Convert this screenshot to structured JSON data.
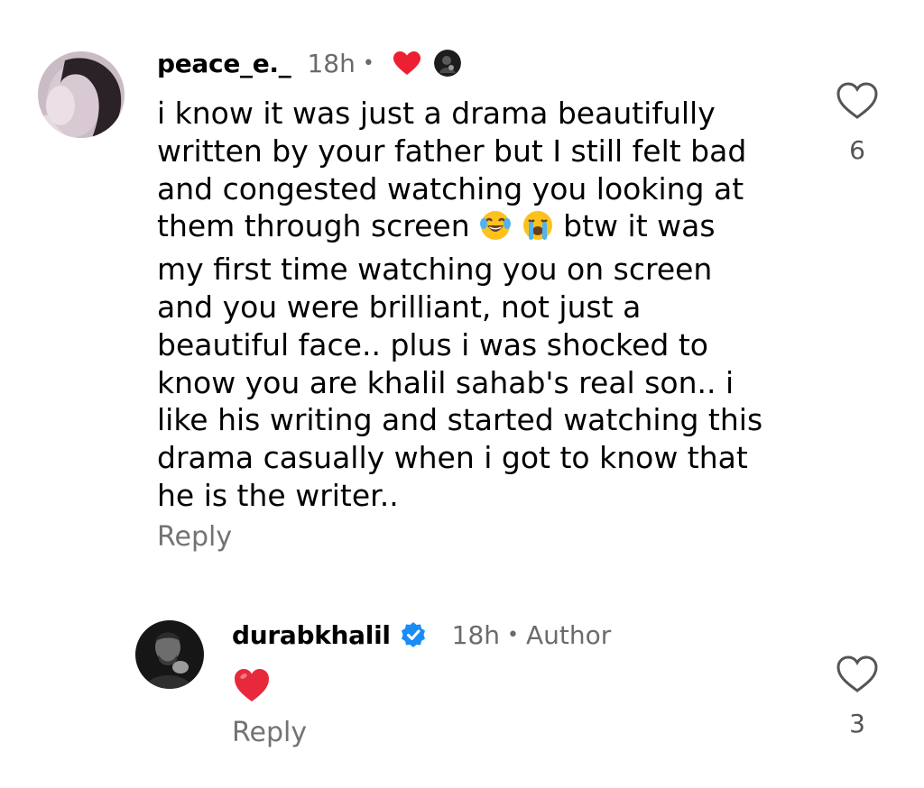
{
  "comments": [
    {
      "username": "peace_e._",
      "time": "18h",
      "separator": "•",
      "text_line_1": "i̇ know it was just a drama beautifully",
      "text_line_2": "written by your father but I still felt bad",
      "text_line_3": "and congested watching you looking at",
      "text_line_4_before": "them through screen",
      "text_line_4_emoji_1": "face-with-tears-of-joy-emoji",
      "text_line_4_emoji_2": "loudly-crying-face-emoji",
      "text_line_4_after": "btw it was",
      "text_line_5": "my first time watching you on screen",
      "text_line_6": "and you were brilliant, not just a",
      "text_line_7": "beautiful face.. plus i was shocked to",
      "text_line_8": "know you are khalil sahab's real son.. i",
      "text_line_9": "like his writing and started watching this",
      "text_line_10": "drama casually when i got to know that",
      "text_line_11": "he is the writer..",
      "reply_label": "Reply",
      "like_count": "6",
      "creator_liked_icon": "red-heart-icon",
      "like_icon": "heart-outline-icon"
    },
    {
      "username": "durabkhalil",
      "verified_icon": "verified-badge-icon",
      "time": "18h",
      "separator": "•",
      "role": "Author",
      "text_emoji": "red-heart-emoji",
      "reply_label": "Reply",
      "like_count": "3",
      "like_icon": "heart-outline-icon"
    }
  ],
  "colors": {
    "heart_red": "#ED1F33",
    "verified_blue": "#1A8CF5",
    "muted_text": "#737373"
  }
}
